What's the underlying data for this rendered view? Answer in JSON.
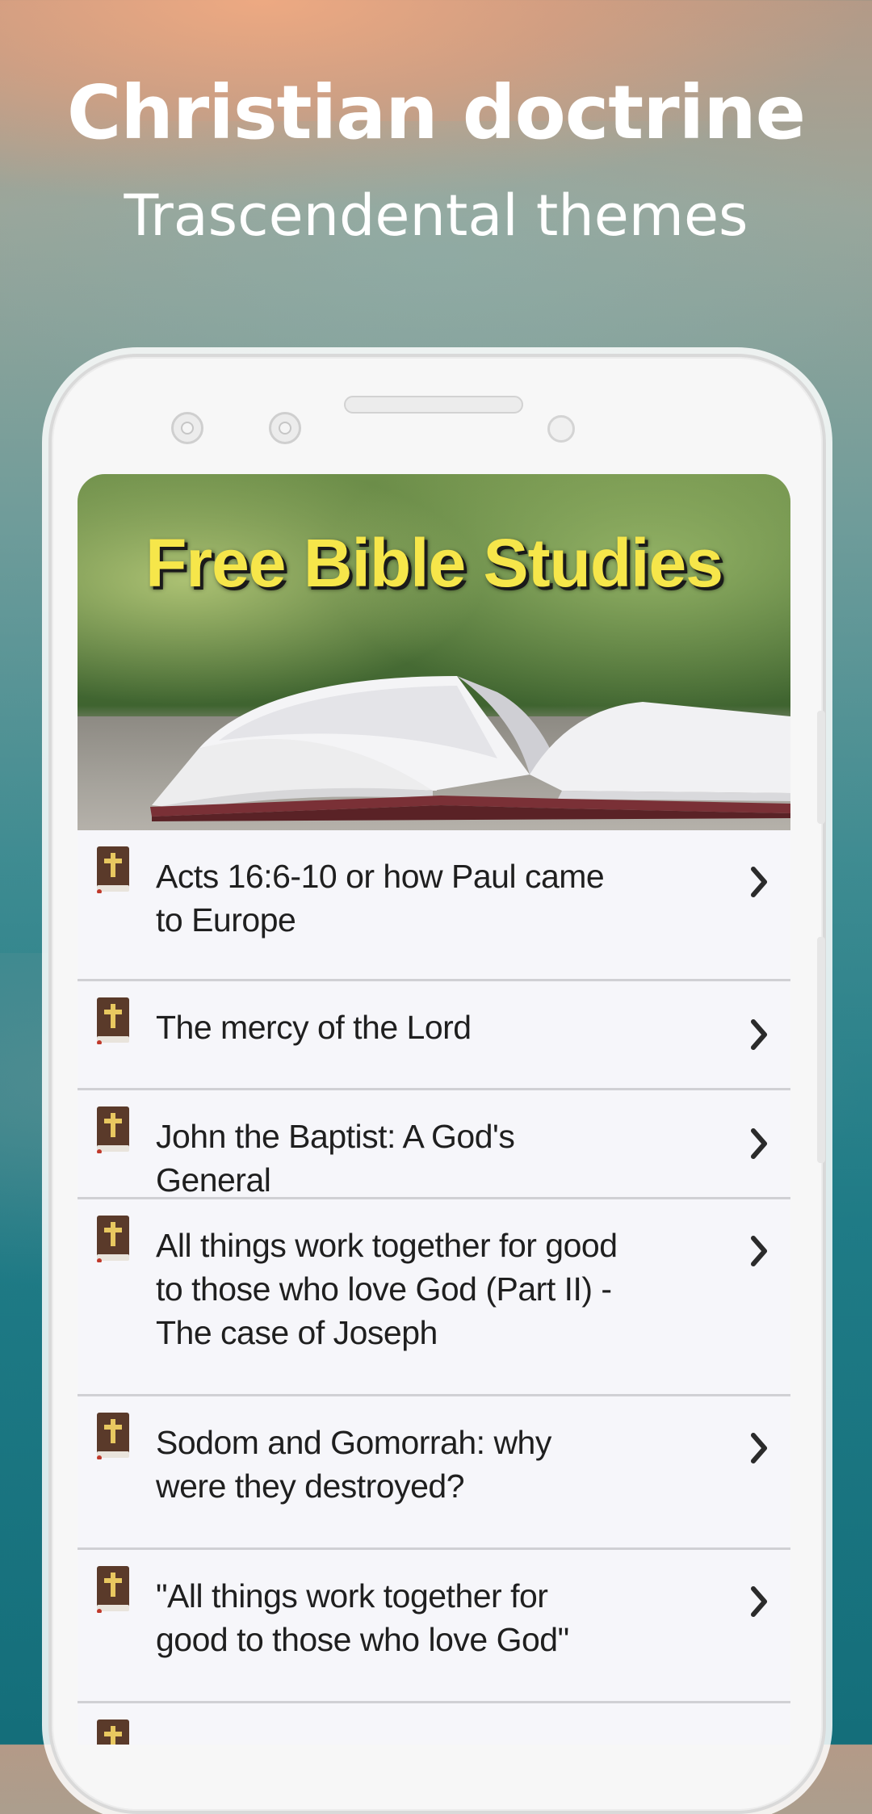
{
  "promo": {
    "title": "Christian doctrine",
    "subtitle": "Trascendental themes"
  },
  "banner": {
    "title": "Free Bible Studies"
  },
  "studies": [
    {
      "title": "Acts 16:6-10 or how Paul came to Europe",
      "icon": "bible-icon"
    },
    {
      "title": "The mercy of the Lord",
      "icon": "bible-icon"
    },
    {
      "title": "John the Baptist: A God's General",
      "icon": "bible-icon"
    },
    {
      "title": "All things work together for good to those who love God (Part II) - The case of Joseph",
      "icon": "bible-icon"
    },
    {
      "title": "Sodom and Gomorrah: why were they destroyed?",
      "icon": "bible-icon"
    },
    {
      "title": "\"All things work together for good to those who love God\"",
      "icon": "bible-icon"
    }
  ],
  "colors": {
    "banner_title": "#f6e64a",
    "list_background": "#f6f6fa",
    "divider": "#d0d0d4",
    "chevron": "#2b2b2b",
    "icon_book": "#5a3a2a",
    "icon_cross": "#e8c860"
  }
}
